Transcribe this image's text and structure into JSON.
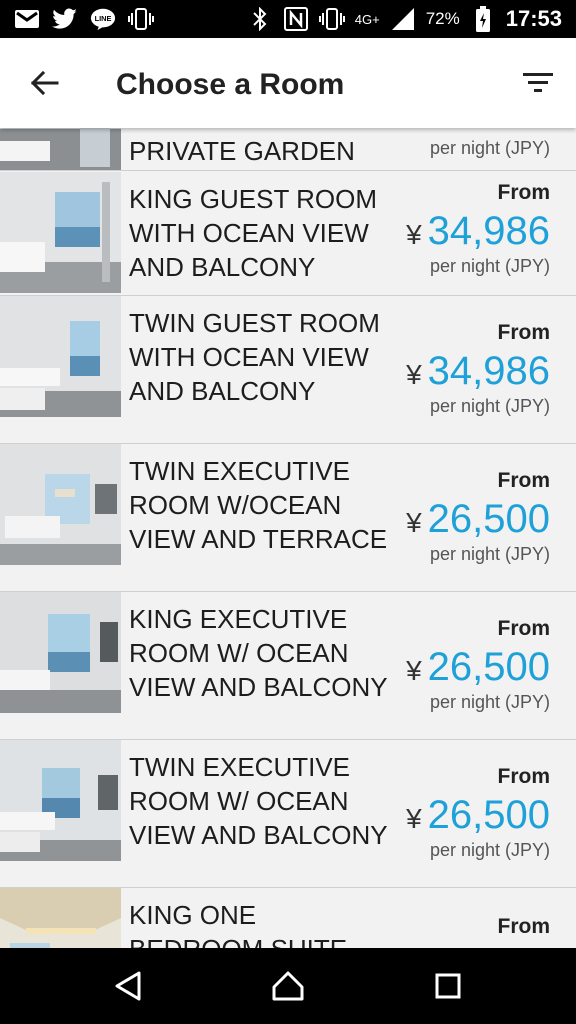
{
  "status_bar": {
    "network": "4G+",
    "battery": "72%",
    "time": "17:53"
  },
  "app_bar": {
    "title": "Choose a Room"
  },
  "rooms": [
    {
      "name": "PRIVATE GARDEN",
      "from": "",
      "currency": "",
      "price": "",
      "per_night": "per night (JPY)"
    },
    {
      "name": "KING GUEST ROOM WITH OCEAN VIEW AND BALCONY",
      "from": "From",
      "currency": "¥",
      "price": "34,986",
      "per_night": "per night (JPY)"
    },
    {
      "name": "TWIN GUEST ROOM WITH OCEAN VIEW AND BALCONY",
      "from": "From",
      "currency": "¥",
      "price": "34,986",
      "per_night": "per night (JPY)"
    },
    {
      "name": "TWIN EXECUTIVE ROOM W/OCEAN VIEW AND TERRACE",
      "from": "From",
      "currency": "¥",
      "price": "26,500",
      "per_night": "per night (JPY)"
    },
    {
      "name": "KING EXECUTIVE ROOM W/ OCEAN VIEW AND BALCONY",
      "from": "From",
      "currency": "¥",
      "price": "26,500",
      "per_night": "per night (JPY)"
    },
    {
      "name": "TWIN EXECUTIVE ROOM W/ OCEAN VIEW AND BALCONY",
      "from": "From",
      "currency": "¥",
      "price": "26,500",
      "per_night": "per night (JPY)"
    },
    {
      "name": "KING ONE BEDROOM SUITE",
      "from": "From",
      "currency": "",
      "price": "",
      "per_night": ""
    }
  ],
  "colors": {
    "price": "#1ea0d8",
    "status_bar": "#000000",
    "list_background": "#f2f2f2"
  },
  "icons": {
    "status_left": [
      "gmail-icon",
      "twitter-icon",
      "line-icon",
      "vibrate-icon"
    ],
    "status_right": [
      "bluetooth-icon",
      "nfc-icon",
      "vibrate-icon",
      "signal-icon",
      "battery-icon"
    ],
    "app_bar": [
      "back-arrow-icon",
      "filter-icon"
    ],
    "nav": [
      "back-triangle-icon",
      "home-circle-icon",
      "recents-square-icon"
    ]
  }
}
